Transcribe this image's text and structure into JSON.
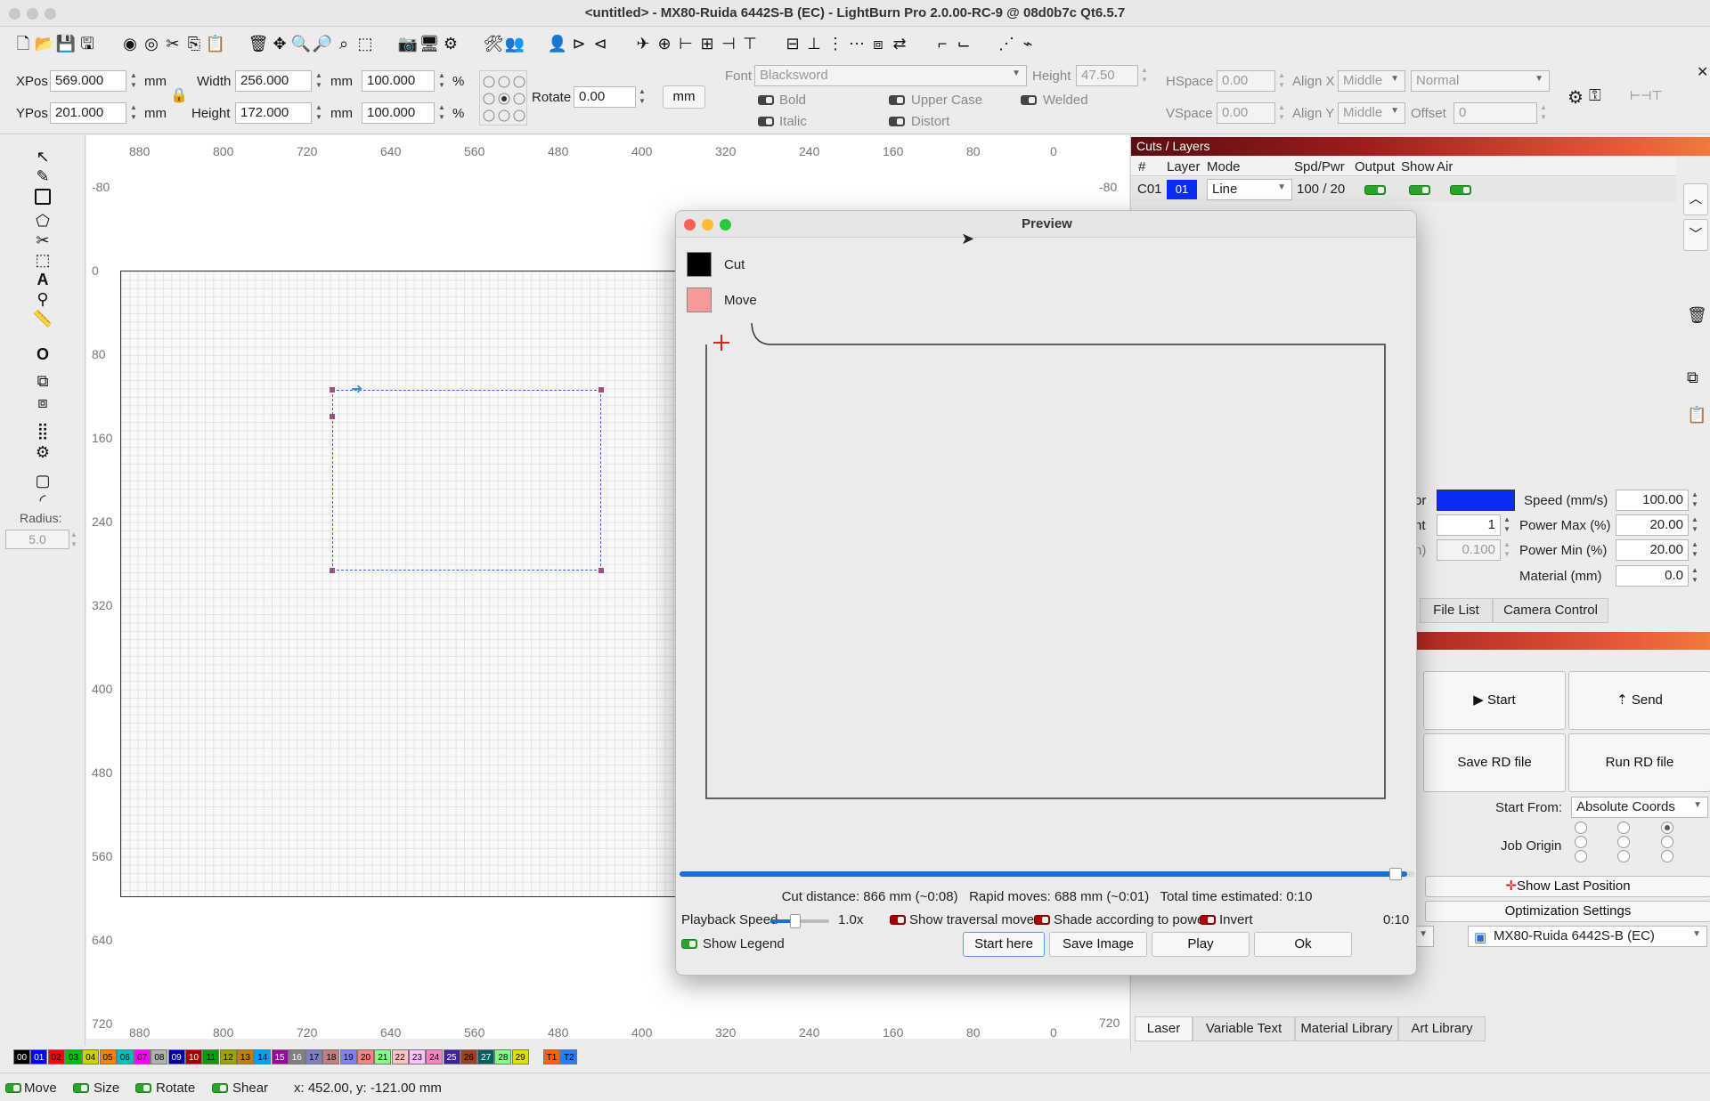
{
  "window": {
    "title": "<untitled> - MX80-Ruida 6442S-B (EC) - LightBurn Pro 2.0.00-RC-9 @ 08d0b7c Qt6.5.7"
  },
  "toolbar": {
    "icons": [
      "new-file-icon",
      "open-file-icon",
      "save-icon",
      "save-as-icon",
      "import-icon",
      "export-icon",
      "cut-icon",
      "copy-icon",
      "paste-icon",
      "delete-icon",
      "move-icon",
      "zoom-in-icon",
      "zoom-out-icon",
      "zoom-fit-icon",
      "zoom-select-icon",
      "camera-icon",
      "monitor-icon",
      "settings-icon",
      "tools-icon",
      "group-icon",
      "user-icon",
      "mirror-h-icon",
      "mirror-v-icon",
      "plane-icon",
      "target-icon",
      "align-left-icon",
      "align-center-icon",
      "align-right-icon",
      "align-top-icon",
      "align-middle-icon",
      "align-bottom-icon",
      "distribute-h-icon",
      "distribute-v-icon",
      "dock-icon",
      "flip-icon",
      "join-icon",
      "break-icon",
      "node-icon",
      "path-icon"
    ]
  },
  "props": {
    "xpos_label": "XPos",
    "xpos": "569.000",
    "ypos_label": "YPos",
    "ypos": "201.000",
    "unit_mm": "mm",
    "width_label": "Width",
    "width": "256.000",
    "height_label": "Height",
    "height": "172.000",
    "scale_w": "100.000",
    "scale_h": "100.000",
    "pct": "%",
    "rotate_label": "Rotate",
    "rotate": "0.00",
    "mm_button": "mm",
    "font_label": "Font",
    "font": "Blacksword",
    "fheight_label": "Height",
    "fheight": "47.50",
    "hspace_label": "HSpace",
    "hspace": "0.00",
    "vspace_label": "VSpace",
    "vspace": "0.00",
    "alignx_label": "Align X",
    "alignx": "Middle",
    "aligny_label": "Align Y",
    "aligny": "Middle",
    "normal": "Normal",
    "offset_label": "Offset",
    "offset": "0",
    "bold": "Bold",
    "italic": "Italic",
    "upper": "Upper Case",
    "distort": "Distort",
    "welded": "Welded"
  },
  "left_tools": {
    "radius_label": "Radius:",
    "radius": "5.0"
  },
  "ruler": {
    "top": [
      "880",
      "800",
      "720",
      "640",
      "560",
      "480",
      "400",
      "320",
      "240",
      "160",
      "80",
      "0"
    ],
    "left": [
      "-80",
      "0",
      "80",
      "160",
      "240",
      "320",
      "400",
      "480",
      "560",
      "640",
      "720"
    ],
    "top_right": "-80",
    "bottom_right": "720"
  },
  "palette": [
    "00",
    "01",
    "02",
    "03",
    "04",
    "05",
    "06",
    "07",
    "08",
    "09",
    "10",
    "11",
    "12",
    "13",
    "14",
    "15",
    "16",
    "17",
    "18",
    "19",
    "20",
    "21",
    "22",
    "23",
    "24",
    "25",
    "26",
    "27",
    "28",
    "29",
    "T1",
    "T2"
  ],
  "palette_colors": [
    "#000000",
    "#0000ff",
    "#ff0000",
    "#00c000",
    "#d0d000",
    "#ff8000",
    "#00c0c0",
    "#ff00ff",
    "#b0b0b0",
    "#0000a0",
    "#a00000",
    "#00a000",
    "#a0a000",
    "#c08000",
    "#00a0ff",
    "#a000a0",
    "#808080",
    "#8080c0",
    "#c08080",
    "#8080ff",
    "#ff8080",
    "#80ff80",
    "#ffc0c0",
    "#ffc0ff",
    "#ff80c0",
    "#4020a0",
    "#a04020",
    "#006060",
    "#80ff80",
    "#e0e000",
    "#ff6000",
    "#2080ff"
  ],
  "status": {
    "move": "Move",
    "size": "Size",
    "rotate": "Rotate",
    "shear": "Shear",
    "coords": "x: 452.00, y: -121.00 mm"
  },
  "layers": {
    "panel_title": "Cuts / Layers",
    "headers": [
      "#",
      "Layer",
      "Mode",
      "Spd/Pwr",
      "Output",
      "Show",
      "Air"
    ],
    "rows": [
      {
        "num": "C01",
        "layer": "01",
        "mode": "Line",
        "spdpwr": "100 / 20"
      }
    ]
  },
  "layer_settings": {
    "color_label": "or",
    "speed_label": "Speed (mm/s)",
    "speed": "100.00",
    "count_label": "nt",
    "count": "1",
    "pmax_label": "Power Max (%)",
    "pmax": "20.00",
    "interval_label": "n)",
    "interval": "0.100",
    "pmin_label": "Power Min (%)",
    "pmin": "20.00",
    "material_label": "Material (mm)",
    "material": "0.0"
  },
  "tabs_mid": [
    "File List",
    "Camera Control"
  ],
  "laser": {
    "start": "Start",
    "send": "Send",
    "save_rd": "Save RD file",
    "run_rd": "Run RD file",
    "start_from_label": "Start From:",
    "start_from": "Absolute Coords",
    "job_origin_label": "Job Origin",
    "show_last": "Show Last Position",
    "optimization": "Optimization Settings",
    "device": "MX80-Ruida 6442S-B (EC)"
  },
  "tabs_bottom": [
    "Laser",
    "Variable Text",
    "Material Library",
    "Art Library"
  ],
  "preview": {
    "title": "Preview",
    "legend": [
      {
        "label": "Cut",
        "color": "#000000"
      },
      {
        "label": "Move",
        "color": "#f39a9a"
      }
    ],
    "stats": "Cut distance: 866 mm (~0:08)   Rapid moves: 688 mm (~0:01)   Total time estimated: 0:10",
    "playback_label": "Playback Speed",
    "playback": "1.0x",
    "show_traversal": "Show traversal moves",
    "shade": "Shade according to power",
    "invert": "Invert",
    "time": "0:10",
    "show_legend": "Show Legend",
    "start_here": "Start here",
    "save_image": "Save Image",
    "play": "Play",
    "ok": "Ok",
    "progress": 0.99
  }
}
